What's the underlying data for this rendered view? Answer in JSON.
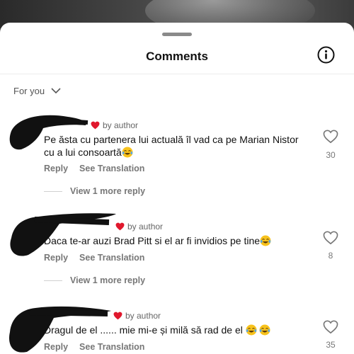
{
  "header": {
    "title": "Comments"
  },
  "filter": {
    "label": "For you"
  },
  "comments": [
    {
      "author_badge": "by author",
      "text": "Pe ăsta cu partenera lui actuală îl vad ca pe Marian Nistor cu a  lui consoartă",
      "emoji_count": 1,
      "reply_label": "Reply",
      "translate_label": "See Translation",
      "likes": "30",
      "more_replies": "View 1 more reply"
    },
    {
      "author_badge": "by author",
      "text": "Daca te-ar auzi Brad Pitt si el ar fi invidios pe tine",
      "emoji_count": 1,
      "reply_label": "Reply",
      "translate_label": "See Translation",
      "likes": "8",
      "more_replies": "View 1 more reply"
    },
    {
      "author_badge": "by author",
      "text": "Dragul de el ...... mie mi-e și milă să rad de el ",
      "emoji_count": 2,
      "reply_label": "Reply",
      "translate_label": "See Translation",
      "likes": "35"
    }
  ],
  "icons": {
    "info": "info-circle-icon",
    "chevron": "chevron-down-icon",
    "heart": "heart-outline-icon",
    "badge_heart": "heart-filled-icon",
    "emoji": "face-with-tears-of-joy-emoji"
  },
  "colors": {
    "badge_heart": "#e0182d",
    "emoji_face": "#f7c21c"
  }
}
